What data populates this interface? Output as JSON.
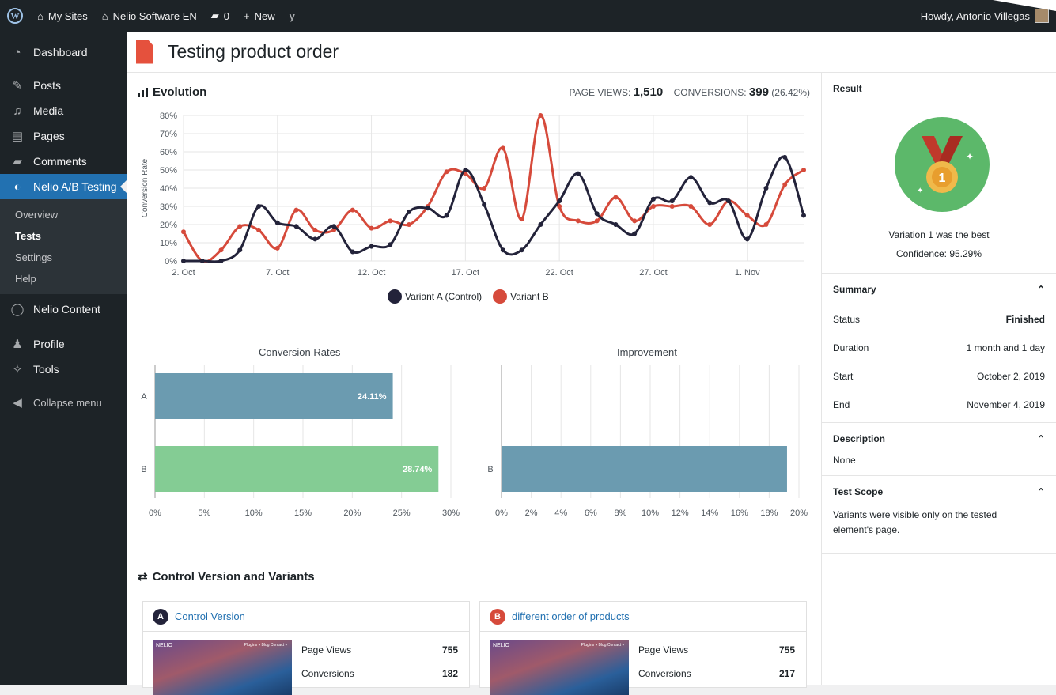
{
  "adminbar": {
    "my_sites": "My Sites",
    "site_name": "Nelio Software EN",
    "comments_count": "0",
    "new_label": "New",
    "howdy": "Howdy, Antonio Villegas"
  },
  "sidebar": {
    "items": [
      {
        "label": "Dashboard",
        "icon": "dashboard-icon"
      },
      {
        "label": "Posts",
        "icon": "pin-icon"
      },
      {
        "label": "Media",
        "icon": "media-icon"
      },
      {
        "label": "Pages",
        "icon": "pages-icon"
      },
      {
        "label": "Comments",
        "icon": "comment-icon"
      },
      {
        "label": "Nelio A/B Testing",
        "icon": "nelio-icon"
      }
    ],
    "submenu": [
      "Overview",
      "Tests",
      "Settings",
      "Help"
    ],
    "items2": [
      {
        "label": "Nelio Content"
      },
      {
        "label": "Profile"
      },
      {
        "label": "Tools"
      },
      {
        "label": "Collapse menu"
      }
    ]
  },
  "page": {
    "title": "Testing product order"
  },
  "evolution": {
    "title": "Evolution",
    "page_views_label": "PAGE VIEWS:",
    "page_views": "1,510",
    "conversions_label": "CONVERSIONS:",
    "conversions": "399",
    "conversion_pct": "(26.42%)"
  },
  "chart_data": [
    {
      "type": "line",
      "ylabel": "Conversion Rate",
      "ylim": [
        0,
        80
      ],
      "y_ticks": [
        "0%",
        "10%",
        "20%",
        "30%",
        "40%",
        "50%",
        "60%",
        "70%",
        "80%"
      ],
      "x_ticks": [
        "2. Oct",
        "7. Oct",
        "12. Oct",
        "17. Oct",
        "22. Oct",
        "27. Oct",
        "1. Nov"
      ],
      "x_days": 34,
      "series": [
        {
          "name": "Variant A (Control)",
          "color": "#23233a",
          "values": [
            0,
            0,
            0,
            6,
            30,
            21,
            19,
            12,
            19,
            5,
            8,
            9,
            27,
            29,
            25,
            50,
            31,
            6,
            6,
            20,
            33,
            48,
            26,
            20,
            15,
            34,
            33,
            46,
            32,
            33,
            12,
            40,
            57,
            25
          ]
        },
        {
          "name": "Variant B",
          "color": "#d64a3b",
          "values": [
            16,
            0,
            6,
            19,
            17,
            7,
            28,
            17,
            17,
            28,
            18,
            22,
            20,
            30,
            49,
            48,
            40,
            62,
            23,
            80,
            30,
            22,
            22,
            35,
            22,
            30,
            30,
            30,
            20,
            33,
            25,
            20,
            42,
            50
          ]
        }
      ]
    },
    {
      "type": "bar",
      "title": "Conversion Rates",
      "categories": [
        "A",
        "B"
      ],
      "values": [
        24.11,
        28.74
      ],
      "labels": [
        "24.11%",
        "28.74%"
      ],
      "colors": [
        "#6b9bb0",
        "#84cc94"
      ],
      "xlim": [
        0,
        30
      ],
      "x_ticks": [
        "0%",
        "5%",
        "10%",
        "15%",
        "20%",
        "25%",
        "30%"
      ]
    },
    {
      "type": "bar",
      "title": "Improvement",
      "categories": [
        "B"
      ],
      "values": [
        19.2
      ],
      "colors": [
        "#6b9bb0"
      ],
      "xlim": [
        0,
        20
      ],
      "x_ticks": [
        "0%",
        "2%",
        "4%",
        "6%",
        "8%",
        "10%",
        "12%",
        "14%",
        "16%",
        "18%",
        "20%"
      ]
    }
  ],
  "variants": {
    "title": "Control Version and Variants",
    "cards": [
      {
        "badge": "A",
        "badge_color": "#23233a",
        "name": "Control Version",
        "page_views_label": "Page Views",
        "page_views": "755",
        "conversions_label": "Conversions",
        "conversions": "182"
      },
      {
        "badge": "B",
        "badge_color": "#d64a3b",
        "name": "different order of products",
        "page_views_label": "Page Views",
        "page_views": "755",
        "conversions_label": "Conversions",
        "conversions": "217"
      }
    ],
    "thumb_logo": "NELIO",
    "thumb_nav": "Plugins ▾   Blog   Contact ▾"
  },
  "result": {
    "title": "Result",
    "best": "Variation 1 was the best",
    "confidence": "Confidence: 95.29%"
  },
  "summary": {
    "title": "Summary",
    "rows": [
      {
        "label": "Status",
        "value": "Finished"
      },
      {
        "label": "Duration",
        "value": "1 month and 1 day"
      },
      {
        "label": "Start",
        "value": "October 2, 2019"
      },
      {
        "label": "End",
        "value": "November 4, 2019"
      }
    ]
  },
  "description": {
    "title": "Description",
    "text": "None"
  },
  "scope": {
    "title": "Test Scope",
    "text": "Variants were visible only on the tested element's page."
  }
}
